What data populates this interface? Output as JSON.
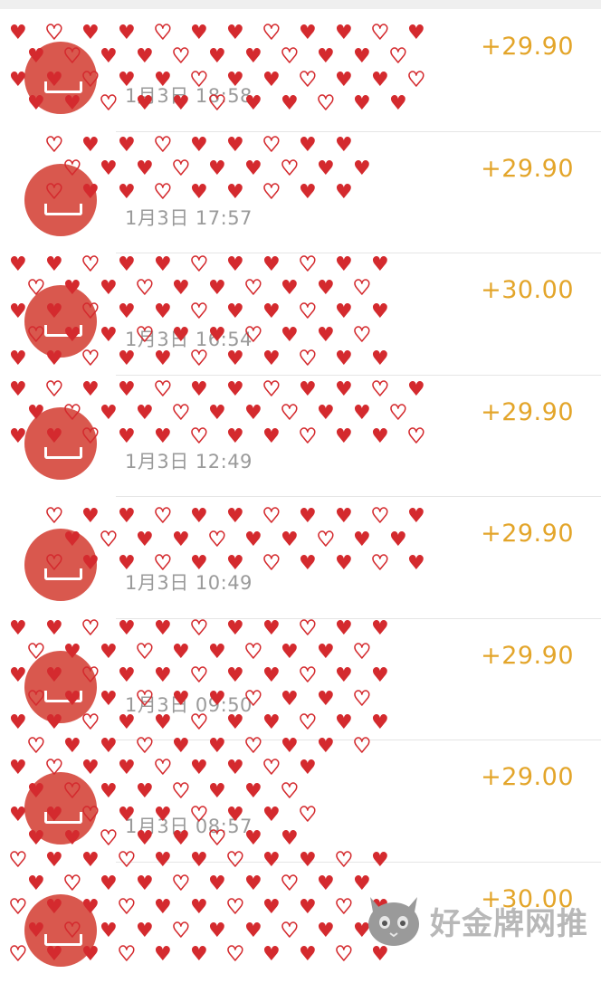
{
  "transactions": [
    {
      "name": "",
      "time": "1月3日 18:58",
      "amount": "+29.90"
    },
    {
      "name": "",
      "time": "1月3日 17:57",
      "amount": "+29.90"
    },
    {
      "name": "",
      "time": "1月3日 16:54",
      "amount": "+30.00"
    },
    {
      "name": "",
      "time": "1月3日 12:49",
      "amount": "+29.90"
    },
    {
      "name": "",
      "time": "1月3日 10:49",
      "amount": "+29.90"
    },
    {
      "name": "",
      "time": "1月3日 09:50",
      "amount": "+29.90"
    },
    {
      "name": "",
      "time": "1月3日 08:57",
      "amount": "+29.00"
    },
    {
      "name": "",
      "time": "",
      "amount": "+30.00"
    }
  ],
  "watermark": {
    "text": "好金牌网推"
  },
  "colors": {
    "amount": "#e3a52a",
    "avatar": "#d9584e",
    "censor": "#d42a2e"
  }
}
